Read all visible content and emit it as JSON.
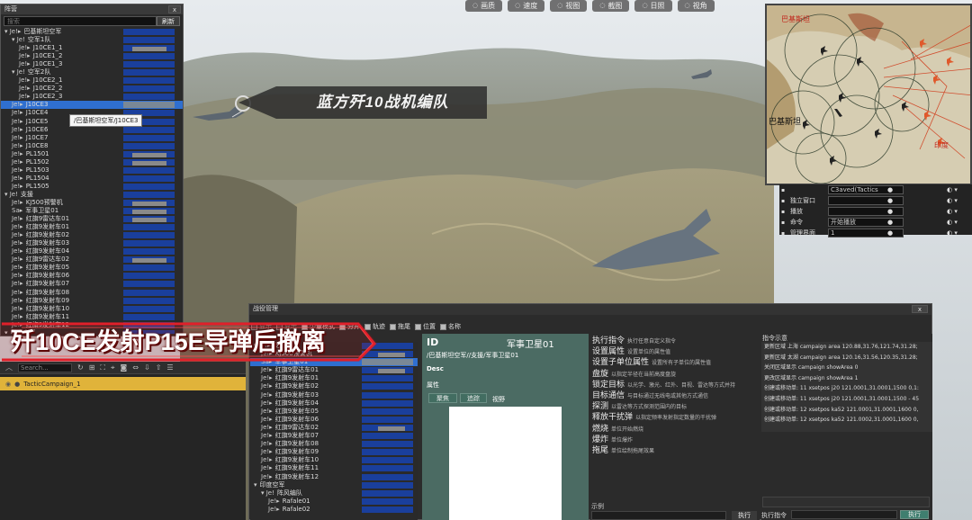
{
  "toolbar": {
    "buttons": [
      {
        "icon": "picture-icon",
        "label": "画质"
      },
      {
        "icon": "speed-icon",
        "label": "速度"
      },
      {
        "icon": "view-icon",
        "label": "视图"
      },
      {
        "icon": "screenshot-icon",
        "label": "截图"
      },
      {
        "icon": "sun-icon",
        "label": "日照"
      },
      {
        "icon": "eye-icon",
        "label": "视角"
      }
    ]
  },
  "formation_panel": {
    "title": "阵营",
    "close": "x",
    "search_placeholder": "搜索",
    "refresh": "刷新",
    "rows": [
      {
        "pre": "▾ Je!▸",
        "label": "巴基斯坦空军",
        "indent": 0,
        "bar": true
      },
      {
        "pre": "▾ Je!",
        "label": "空军1队",
        "indent": 1,
        "bar": true
      },
      {
        "pre": "Je!▸",
        "label": "J10CE1_1",
        "indent": 2,
        "bar": true,
        "gray": true
      },
      {
        "pre": "Je!▸",
        "label": "J10CE1_2",
        "indent": 2,
        "bar": true
      },
      {
        "pre": "Je!▸",
        "label": "J10CE1_3",
        "indent": 2,
        "bar": true
      },
      {
        "pre": "▾ Je!",
        "label": "空军2队",
        "indent": 1,
        "bar": true
      },
      {
        "pre": "Je!▸",
        "label": "J10CE2_1",
        "indent": 2,
        "bar": true
      },
      {
        "pre": "Je!▸",
        "label": "J10CE2_2",
        "indent": 2,
        "bar": true
      },
      {
        "pre": "Je!▸",
        "label": "J10CE2_3",
        "indent": 2,
        "bar": true
      },
      {
        "pre": "Je!▸",
        "label": "J10CE3",
        "indent": 1,
        "bar": true,
        "selected": true
      },
      {
        "pre": "Je!▸",
        "label": "J10CE4",
        "indent": 1,
        "bar": true
      },
      {
        "pre": "Je!▸",
        "label": "J10CE5",
        "indent": 1,
        "bar": true
      },
      {
        "pre": "Je!▸",
        "label": "J10CE6",
        "indent": 1,
        "bar": true
      },
      {
        "pre": "Je!▸",
        "label": "J10CE7",
        "indent": 1,
        "bar": true
      },
      {
        "pre": "Je!▸",
        "label": "J10CE8",
        "indent": 1,
        "bar": true
      },
      {
        "pre": "Je!▸",
        "label": "PL1501",
        "indent": 1,
        "bar": true,
        "gray": true
      },
      {
        "pre": "Je!▸",
        "label": "PL1502",
        "indent": 1,
        "bar": true,
        "gray": true
      },
      {
        "pre": "Je!▸",
        "label": "PL1503",
        "indent": 1,
        "bar": true
      },
      {
        "pre": "Je!▸",
        "label": "PL1504",
        "indent": 1,
        "bar": true
      },
      {
        "pre": "Je!▸",
        "label": "PL1505",
        "indent": 1,
        "bar": true
      },
      {
        "pre": "▾ Je!",
        "label": "支援",
        "indent": 0,
        "bar": true
      },
      {
        "pre": "Je!▸",
        "label": "KJ500预警机",
        "indent": 1,
        "bar": true,
        "gray": true
      },
      {
        "pre": "Sa▸",
        "label": "军事卫星01",
        "indent": 1,
        "bar": true,
        "gray": true
      },
      {
        "pre": "Je!▸",
        "label": "红旗9雷达车01",
        "indent": 1,
        "bar": true,
        "gray": true
      },
      {
        "pre": "Je!▸",
        "label": "红旗9发射车01",
        "indent": 1,
        "bar": true
      },
      {
        "pre": "Je!▸",
        "label": "红旗9发射车02",
        "indent": 1,
        "bar": true
      },
      {
        "pre": "Je!▸",
        "label": "红旗9发射车03",
        "indent": 1,
        "bar": true
      },
      {
        "pre": "Je!▸",
        "label": "红旗9发射车04",
        "indent": 1,
        "bar": true
      },
      {
        "pre": "Je!▸",
        "label": "红旗9雷达车02",
        "indent": 1,
        "bar": true,
        "gray": true
      },
      {
        "pre": "Je!▸",
        "label": "红旗9发射车05",
        "indent": 1,
        "bar": true
      },
      {
        "pre": "Je!▸",
        "label": "红旗9发射车06",
        "indent": 1,
        "bar": true
      },
      {
        "pre": "Je!▸",
        "label": "红旗9发射车07",
        "indent": 1,
        "bar": true
      },
      {
        "pre": "Je!▸",
        "label": "红旗9发射车08",
        "indent": 1,
        "bar": true
      },
      {
        "pre": "Je!▸",
        "label": "红旗9发射车09",
        "indent": 1,
        "bar": true
      },
      {
        "pre": "Je!▸",
        "label": "红旗9发射车10",
        "indent": 1,
        "bar": true
      },
      {
        "pre": "Je!▸",
        "label": "红旗9发射车11",
        "indent": 1,
        "bar": true
      },
      {
        "pre": "Je!▸",
        "label": "红旗9发射车12",
        "indent": 1,
        "bar": true
      },
      {
        "pre": "▾",
        "label": "印度空军",
        "indent": 0,
        "bar": true
      }
    ],
    "tooltip": "/巴基斯坦空军/J10CE3"
  },
  "scene": {
    "formation_label": "蓝方歼10战机编队",
    "caption": "歼10CE发射P15E导弹后撤离",
    "minimap_labels": [
      "巴基斯坦",
      "巴基斯坦",
      "印度"
    ]
  },
  "props_panel": {
    "rows": [
      {
        "key": "",
        "value": "C3aved(Tactics",
        "dot": "●",
        "ctrl": "◐ ▾"
      },
      {
        "key": "独立窗口",
        "value": "",
        "dot": "●",
        "ctrl": "◐ ▾"
      },
      {
        "key": "播放",
        "value": "",
        "dot": "●",
        "ctrl": "◐ ▾"
      },
      {
        "key": "命令",
        "value": "开始播放",
        "dot": "●",
        "ctrl": "◐ ▾"
      },
      {
        "key": "管理界面",
        "value": "1",
        "dot": "●",
        "ctrl": "◐ ▾"
      }
    ]
  },
  "campaign_panel": {
    "title": "战役管理",
    "close": "x",
    "filters": [
      {
        "label": "显示",
        "checked": false
      },
      {
        "label": "显示",
        "checked": false
      },
      {
        "label": "少量模式",
        "checked": true
      },
      {
        "label": "分开",
        "checked": true
      },
      {
        "label": "轨迹",
        "checked": true
      },
      {
        "label": "拖尾",
        "checked": true
      },
      {
        "label": "位置",
        "checked": true
      },
      {
        "label": "名称",
        "checked": true
      }
    ],
    "refresh": "刷新",
    "tree": [
      {
        "pre": "▾ Je!▸",
        "label": "支援",
        "indent": 0
      },
      {
        "pre": "Je!▸",
        "label": "KJ500预警机",
        "indent": 1,
        "gray": true
      },
      {
        "pre": "Sa▸",
        "label": "军事卫星01",
        "indent": 1,
        "selected": true
      },
      {
        "pre": "Je!▸",
        "label": "红旗9雷达车01",
        "indent": 1,
        "gray": true
      },
      {
        "pre": "Je!▸",
        "label": "红旗9发射车01",
        "indent": 1
      },
      {
        "pre": "Je!▸",
        "label": "红旗9发射车02",
        "indent": 1
      },
      {
        "pre": "Je!▸",
        "label": "红旗9发射车03",
        "indent": 1
      },
      {
        "pre": "Je!▸",
        "label": "红旗9发射车04",
        "indent": 1
      },
      {
        "pre": "Je!▸",
        "label": "红旗9发射车05",
        "indent": 1
      },
      {
        "pre": "Je!▸",
        "label": "红旗9发射车06",
        "indent": 1
      },
      {
        "pre": "Je!▸",
        "label": "红旗9雷达车02",
        "indent": 1,
        "gray": true
      },
      {
        "pre": "Je!▸",
        "label": "红旗9发射车07",
        "indent": 1
      },
      {
        "pre": "Je!▸",
        "label": "红旗9发射车08",
        "indent": 1
      },
      {
        "pre": "Je!▸",
        "label": "红旗9发射车09",
        "indent": 1
      },
      {
        "pre": "Je!▸",
        "label": "红旗9发射车10",
        "indent": 1
      },
      {
        "pre": "Je!▸",
        "label": "红旗9发射车11",
        "indent": 1
      },
      {
        "pre": "Je!▸",
        "label": "红旗9发射车12",
        "indent": 1
      },
      {
        "pre": "▾",
        "label": "印度空军",
        "indent": 0
      },
      {
        "pre": "▾ Je!",
        "label": "阵风编队",
        "indent": 1
      },
      {
        "pre": "Je!▸",
        "label": "Rafale01",
        "indent": 2
      },
      {
        "pre": "Je!▸",
        "label": "Rafale02",
        "indent": 2
      }
    ],
    "id_panel": {
      "id_label": "ID",
      "name": "军事卫星01",
      "path": "/巴基斯坦空军//支援/军事卫星01",
      "desc": "Desc",
      "attr": "属性",
      "btn_focus": "聚焦",
      "btn_track": "追踪",
      "view": "视野"
    },
    "commands": [
      {
        "name": "执行指令",
        "desc": "执行任意自定义指令"
      },
      {
        "name": "设置属性",
        "desc": "设置单位的属性值"
      },
      {
        "name": "设置子单位属性",
        "desc": "设置所有子单位的属性值"
      },
      {
        "name": "盘旋",
        "desc": "以指定半径在当前高度盘旋"
      },
      {
        "name": "锁定目标",
        "desc": "以光学、激光、红外、目视、雷达等方式并持"
      },
      {
        "name": "目标通信",
        "desc": "与目标通过无线电或其他方式通信"
      },
      {
        "name": "探测",
        "desc": "以雷达等方式探测范围内的目标"
      },
      {
        "name": "释放干扰弹",
        "desc": "以指定频率发射指定数量的干扰弹"
      },
      {
        "name": "燃烧",
        "desc": "单位开始燃烧"
      },
      {
        "name": "爆炸",
        "desc": "单位爆炸"
      },
      {
        "name": "拖尾",
        "desc": "单位绘制拖尾效果"
      }
    ],
    "example_label": "示例",
    "execute": "执行",
    "log_title": "指令示意",
    "log": [
      "更新区域 上海 campaign area 120.88,31.76,121.74,31.28;",
      "更新区域 太湖 campaign area 120.16,31.56,120.35,31.28;",
      "关闭区域显示 campaign showArea 0",
      "更改区域显示 campaign showArea 1",
      "创建或移动单: 11 xsetpos j20 121.0001,31.0001,1500 0,1:",
      "创建或移动单: 11 xsetpos j20 121.0001,31.0001,1500 - 45",
      "创建或移动单: 12 xsetpos ka52 121.0001,31.0001,1600 0,",
      "创建或移动单: 12 xsetpos ka52 121.0002,31.0001,1600 0,"
    ],
    "exec_cmd_label": "执行指令",
    "exec_btn": "执行"
  },
  "tactic_panel": {
    "search_placeholder": "Search...",
    "item": "TacticCampaign_1"
  }
}
